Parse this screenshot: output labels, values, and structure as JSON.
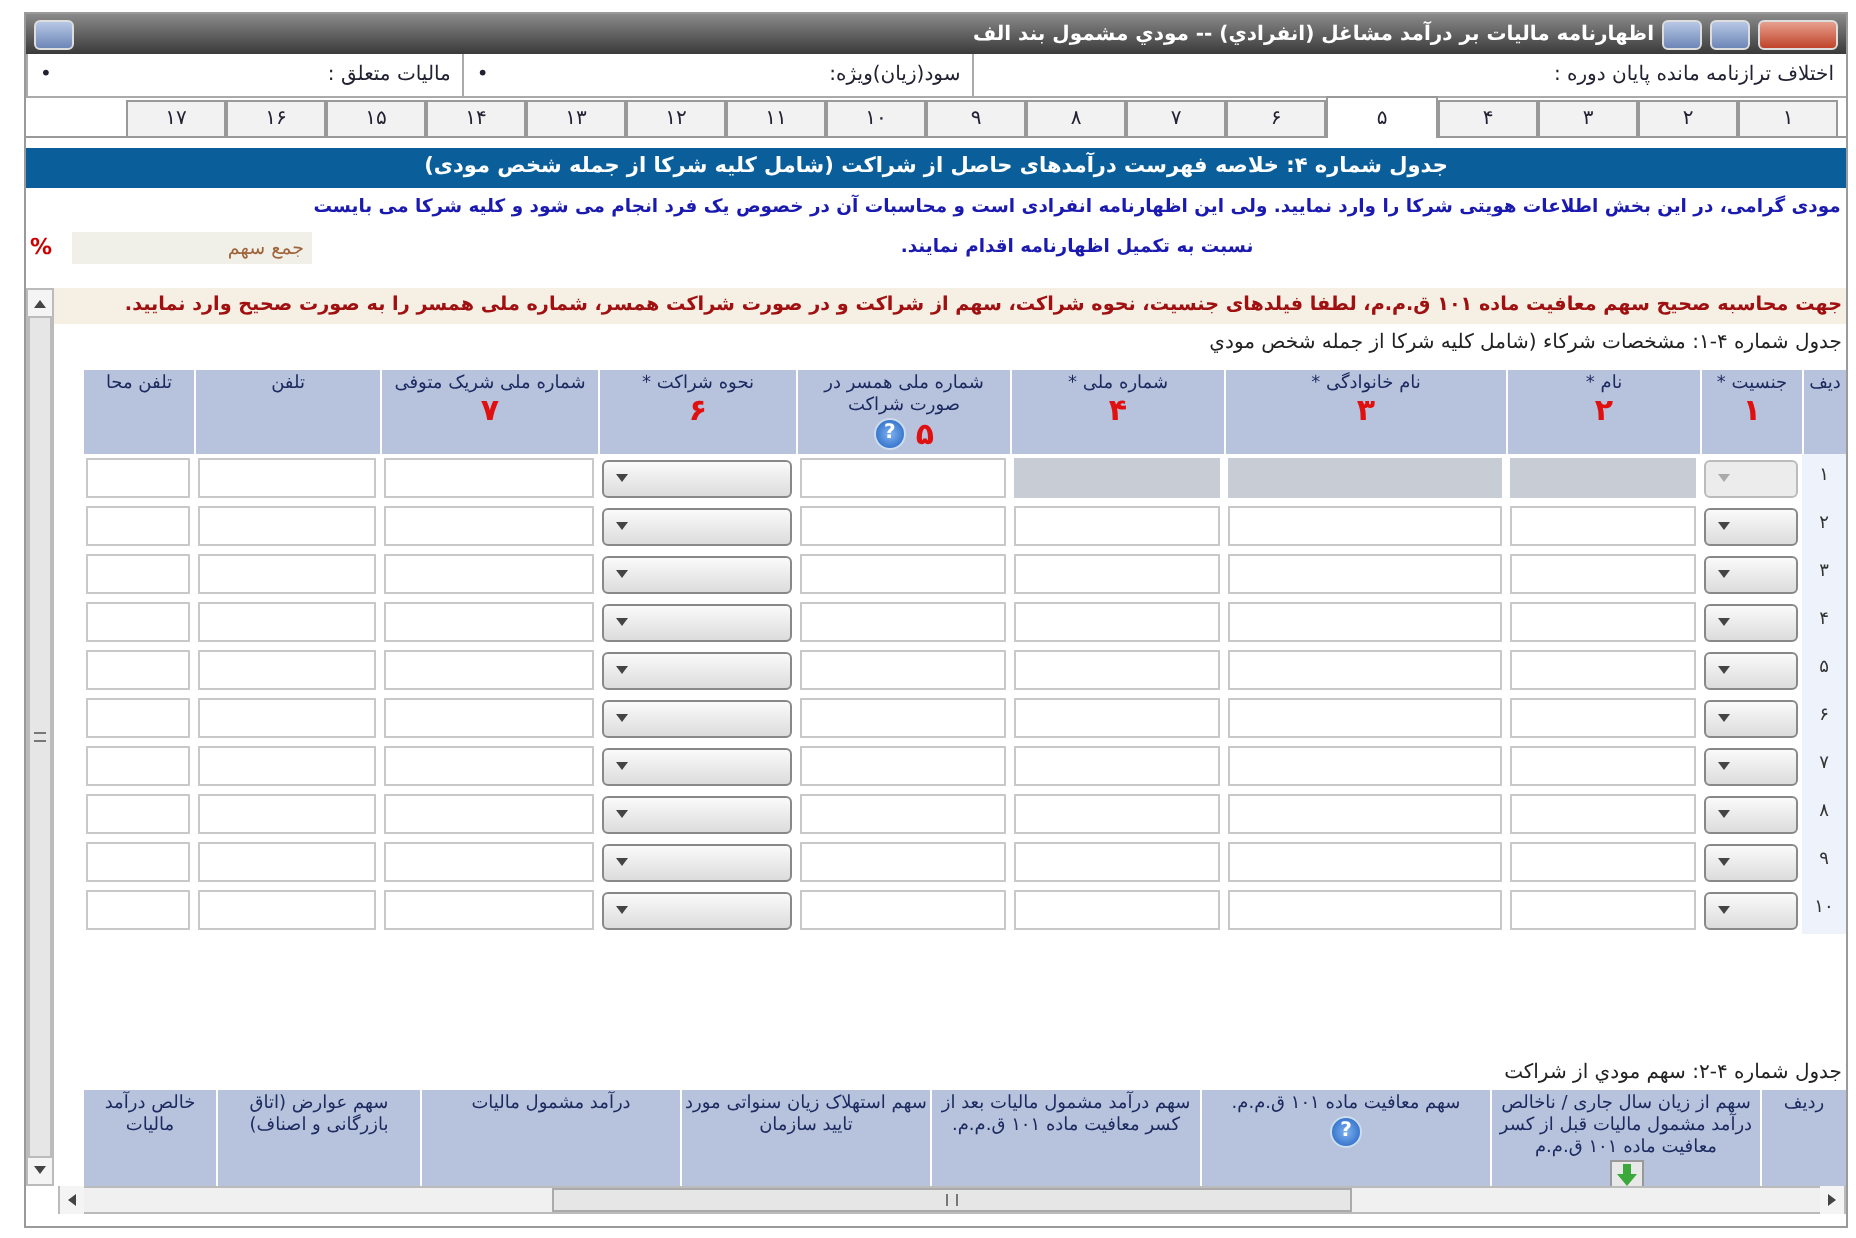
{
  "window": {
    "title": "اظهارنامه ماليات بر درآمد مشاغل (انفرادي) -- مودي مشمول بند الف"
  },
  "summary": [
    {
      "label": "اختلاف ترازنامه مانده پایان دوره :"
    },
    {
      "label": "سود(زیان)ویژه:",
      "value": "•"
    },
    {
      "label": "مالیات متعلق :",
      "value": "•"
    }
  ],
  "tabs": [
    {
      "label": "۱",
      "selected": false
    },
    {
      "label": "۲",
      "selected": false
    },
    {
      "label": "۳",
      "selected": false
    },
    {
      "label": "۴",
      "selected": false
    },
    {
      "label": "۵",
      "selected": true
    },
    {
      "label": "۶",
      "selected": false
    },
    {
      "label": "۷",
      "selected": false
    },
    {
      "label": "۸",
      "selected": false
    },
    {
      "label": "۹",
      "selected": false
    },
    {
      "label": "۱۰",
      "selected": false
    },
    {
      "label": "۱۱",
      "selected": false
    },
    {
      "label": "۱۲",
      "selected": false
    },
    {
      "label": "۱۳",
      "selected": false
    },
    {
      "label": "۱۴",
      "selected": false
    },
    {
      "label": "۱۵",
      "selected": false
    },
    {
      "label": "۱۶",
      "selected": false
    },
    {
      "label": "۱۷",
      "selected": false
    }
  ],
  "section_title": "جدول شماره ۴: خلاصه فهرست درآمدهای حاصل از شراکت (شامل کلیه شرکا از جمله شخص مودی)",
  "notice": "مودی گرامی، در این بخش اطلاعات هویتی شرکا را وارد نمایید. ولی این اظهارنامه انفرادی است و محاسبات آن در خصوص یک فرد انجام می شود و کلیه شرکا می بایست نسبت به تکمیل اظهارنامه اقدام نمایند.",
  "share_total": {
    "placeholder": "جمع سهم",
    "unit": "%"
  },
  "warning": "جهت محاسبه صحیح سهم معافیت ماده ۱۰۱ ق.م.م، لطفا فیلدهای جنسیت، نحوه شراکت، سهم از شراکت و در صورت شراکت همسر، شماره ملی همسر را به صورت صحیح وارد نمایید.",
  "partners_table": {
    "caption": "جدول شماره ۴-۱: مشخصات شرکاء (شامل کلیه شرکا از جمله شخص مودي",
    "columns": [
      {
        "label": "دیف",
        "kind": "index"
      },
      {
        "label": "جنسیت *",
        "number": "۱",
        "kind": "select",
        "lockable": true
      },
      {
        "label": "نام *",
        "number": "۲",
        "kind": "text",
        "lockable": true
      },
      {
        "label": "نام خانوادگی *",
        "number": "۳",
        "kind": "text",
        "lockable": true
      },
      {
        "label": "شماره ملی *",
        "number": "۴",
        "kind": "text",
        "lockable": true
      },
      {
        "label": "شماره ملی همسر در صورت شراکت",
        "number": "۵",
        "kind": "text",
        "help": "?"
      },
      {
        "label": "نحوه شراکت *",
        "number": "۶",
        "kind": "select"
      },
      {
        "label": "شماره ملی شریک متوفی",
        "number": "۷",
        "kind": "text"
      },
      {
        "label": "تلفن",
        "kind": "text"
      },
      {
        "label": "تلفن محا",
        "kind": "text"
      }
    ],
    "rows": [
      {
        "index": "۱",
        "locked": true
      },
      {
        "index": "۲",
        "locked": false
      },
      {
        "index": "۳",
        "locked": false
      },
      {
        "index": "۴",
        "locked": false
      },
      {
        "index": "۵",
        "locked": false
      },
      {
        "index": "۶",
        "locked": false
      },
      {
        "index": "۷",
        "locked": false
      },
      {
        "index": "۸",
        "locked": false
      },
      {
        "index": "۹",
        "locked": false
      },
      {
        "index": "۱۰",
        "locked": false
      }
    ]
  },
  "share_table": {
    "caption": "جدول شماره ۴-۲: سهم مودي از شراکت",
    "columns": [
      {
        "label": "ردیف"
      },
      {
        "label": "سهم از زیان سال جاری / ناخالص درآمد مشمول مالیات قبل از کسر معافیت ماده ۱۰۱ ق.م.م",
        "import": true
      },
      {
        "label": "سهم معافیت ماده ۱۰۱ ق.م.م.",
        "help": "?"
      },
      {
        "label": "سهم درآمد مشمول مالیات بعد از کسر معافیت ماده ۱۰۱ ق.م.م."
      },
      {
        "label": "سهم استهلاک زیان سنواتی مورد تایید سازمان"
      },
      {
        "label": "درآمد مشمول مالیات"
      },
      {
        "label": "سهم عوارض (اتاق بازرگانی و اصناف)"
      },
      {
        "label": "خالص درآمد مالیات"
      }
    ]
  }
}
